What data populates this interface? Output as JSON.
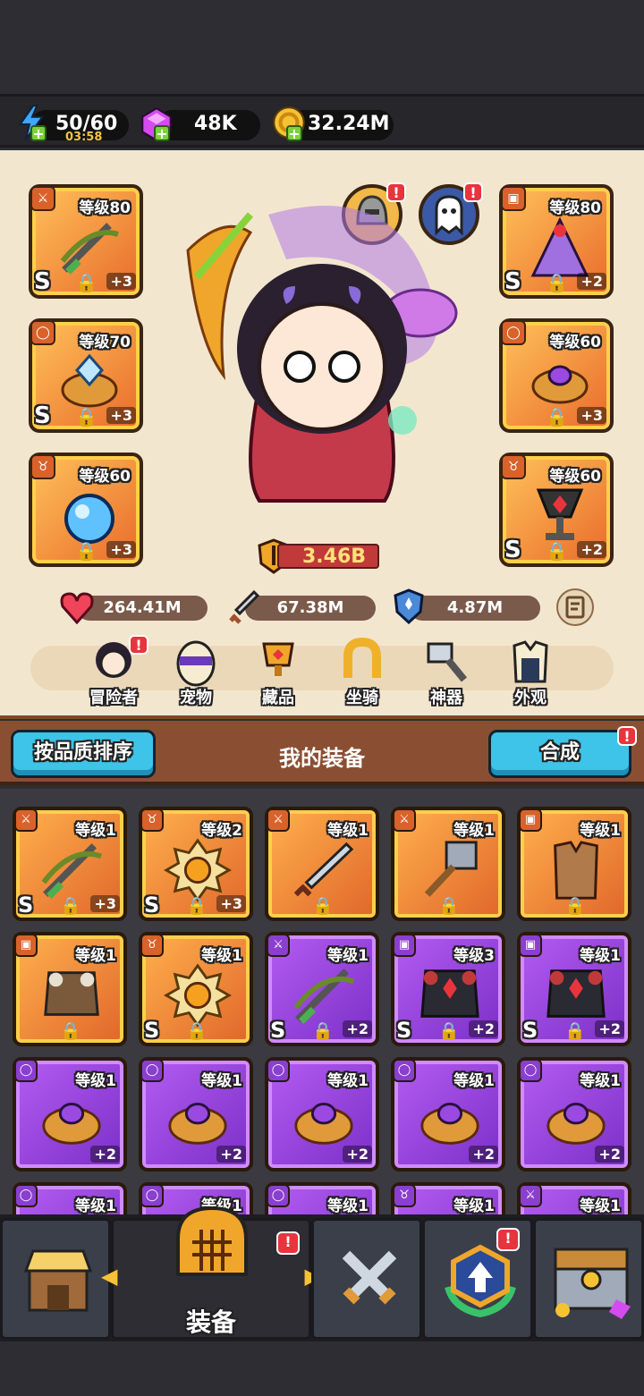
{
  "resources": {
    "energy": "50/60",
    "energy_timer": "03:58",
    "gems": "48K",
    "gold": "32.24M"
  },
  "hero_slots": {
    "left": [
      {
        "level": "等级80",
        "grade": "S",
        "bonus": "+3"
      },
      {
        "level": "等级70",
        "grade": "S",
        "bonus": "+3"
      },
      {
        "level": "等级60",
        "grade": "",
        "bonus": "+3"
      }
    ],
    "right": [
      {
        "level": "等级80",
        "grade": "S",
        "bonus": "+2"
      },
      {
        "level": "等级60",
        "grade": "",
        "bonus": "+3"
      },
      {
        "level": "等级60",
        "grade": "S",
        "bonus": "+2"
      }
    ]
  },
  "power": "3.46B",
  "stats": {
    "hp": "264.41M",
    "attack": "67.38M",
    "defense": "4.87M"
  },
  "nav": [
    "冒险者",
    "宠物",
    "藏品",
    "坐骑",
    "神器",
    "外观"
  ],
  "equip_bar": {
    "sort_label": "按品质排序",
    "title": "我的装备",
    "merge_label": "合成"
  },
  "items": [
    {
      "level": "等级1",
      "grade": "S",
      "bonus": "+3",
      "rarity": "orange",
      "art": "bow"
    },
    {
      "level": "等级2",
      "grade": "S",
      "bonus": "+3",
      "rarity": "orange",
      "art": "amulet"
    },
    {
      "level": "等级1",
      "grade": "",
      "bonus": "",
      "rarity": "orange",
      "art": "sword"
    },
    {
      "level": "等级1",
      "grade": "",
      "bonus": "",
      "rarity": "orange",
      "art": "hammer"
    },
    {
      "level": "等级1",
      "grade": "",
      "bonus": "",
      "rarity": "orange",
      "art": "vest"
    },
    {
      "level": "等级1",
      "grade": "",
      "bonus": "",
      "rarity": "orange",
      "art": "armor"
    },
    {
      "level": "等级1",
      "grade": "S",
      "bonus": "",
      "rarity": "orange",
      "art": "amulet"
    },
    {
      "level": "等级1",
      "grade": "S",
      "bonus": "+2",
      "rarity": "purple",
      "art": "bow"
    },
    {
      "level": "等级3",
      "grade": "S",
      "bonus": "+2",
      "rarity": "purple",
      "art": "darkarmor"
    },
    {
      "level": "等级1",
      "grade": "S",
      "bonus": "+2",
      "rarity": "purple",
      "art": "darkarmor"
    },
    {
      "level": "等级1",
      "grade": "",
      "bonus": "+2",
      "rarity": "purple",
      "art": "ring"
    },
    {
      "level": "等级1",
      "grade": "",
      "bonus": "+2",
      "rarity": "purple",
      "art": "ring"
    },
    {
      "level": "等级1",
      "grade": "",
      "bonus": "+2",
      "rarity": "purple",
      "art": "ring"
    },
    {
      "level": "等级1",
      "grade": "",
      "bonus": "+2",
      "rarity": "purple",
      "art": "ring"
    },
    {
      "level": "等级1",
      "grade": "",
      "bonus": "+2",
      "rarity": "purple",
      "art": "ring"
    },
    {
      "level": "等级1",
      "grade": "",
      "bonus": "",
      "rarity": "purple",
      "art": "ring"
    },
    {
      "level": "等级1",
      "grade": "",
      "bonus": "",
      "rarity": "purple",
      "art": "ring"
    },
    {
      "level": "等级1",
      "grade": "",
      "bonus": "",
      "rarity": "purple",
      "art": "ring"
    },
    {
      "level": "等级1",
      "grade": "",
      "bonus": "",
      "rarity": "purple",
      "art": "amulet"
    },
    {
      "level": "等级1",
      "grade": "",
      "bonus": "",
      "rarity": "purple",
      "art": "sword"
    }
  ],
  "bottom_nav": {
    "active_label": "装备"
  },
  "alert_mark": "!"
}
